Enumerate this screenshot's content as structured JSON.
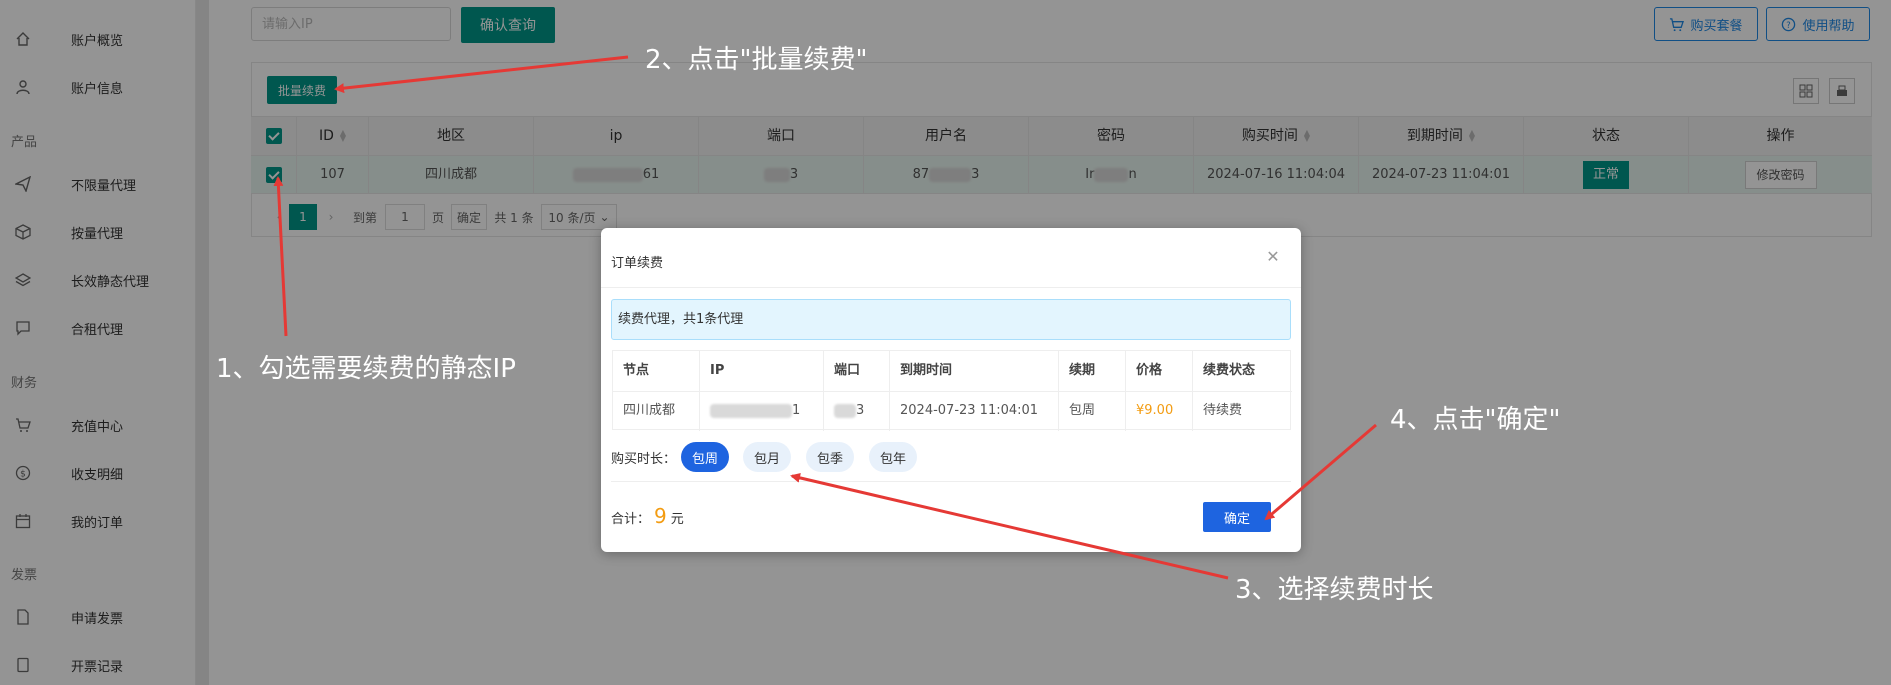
{
  "sidebar": {
    "items": [
      {
        "label": "账户概览",
        "icon": "home-icon"
      },
      {
        "label": "账户信息",
        "icon": "user-icon"
      },
      {
        "label": "不限量代理",
        "icon": "send-icon"
      },
      {
        "label": "按量代理",
        "icon": "box-icon"
      },
      {
        "label": "长效静态代理",
        "icon": "layers-icon"
      },
      {
        "label": "合租代理",
        "icon": "chat-icon"
      },
      {
        "label": "充值中心",
        "icon": "cart-icon"
      },
      {
        "label": "收支明细",
        "icon": "coin-icon"
      },
      {
        "label": "我的订单",
        "icon": "calendar-icon"
      },
      {
        "label": "申请发票",
        "icon": "file-icon"
      },
      {
        "label": "开票记录",
        "icon": "record-icon"
      }
    ],
    "sections": [
      "产品",
      "财务",
      "发票"
    ]
  },
  "toolbar": {
    "ip_placeholder": "请输入IP",
    "query_label": "确认查询",
    "buy_label": "购买套餐",
    "help_label": "使用帮助",
    "batch_label": "批量续费"
  },
  "table": {
    "headers": [
      "ID",
      "地区",
      "ip",
      "端口",
      "用户名",
      "密码",
      "购买时间",
      "到期时间",
      "状态",
      "操作"
    ],
    "row": {
      "id": "107",
      "region": "四川成都",
      "ip_tail": "61",
      "port_tail": "3",
      "user_prefix": "87",
      "user_tail": "3",
      "pwd_prefix": "Ir",
      "pwd_tail": "n",
      "buy_time": "2024-07-16 11:04:04",
      "expire_time": "2024-07-23 11:04:01",
      "status": "正常",
      "action": "修改密码"
    }
  },
  "pager": {
    "current": "1",
    "goto_label": "到第",
    "page_value": "1",
    "page_unit": "页",
    "confirm_label": "确定",
    "total_label": "共 1 条",
    "size_label": "10 条/页"
  },
  "modal": {
    "title": "订单续费",
    "info": "续费代理，共1条代理",
    "headers": [
      "节点",
      "IP",
      "端口",
      "到期时间",
      "续期",
      "价格",
      "续费状态"
    ],
    "row": {
      "node": "四川成都",
      "ip_tail": "1",
      "port_tail": "3",
      "expire_time": "2024-07-23 11:04:01",
      "renew": "包周",
      "price": "¥9.00",
      "status": "待续费"
    },
    "duration_label": "购买时长：",
    "durations": [
      "包周",
      "包月",
      "包季",
      "包年"
    ],
    "total_label": "合计：",
    "total_value": "9",
    "total_unit": "元",
    "confirm_label": "确定"
  },
  "annotations": {
    "step1": "1、勾选需要续费的静态IP",
    "step2": "2、点击\"批量续费\"",
    "step3": "3、选择续费时长",
    "step4": "4、点击\"确定\""
  },
  "colors": {
    "primary_green": "#009688",
    "primary_blue": "#1e64e0",
    "price_orange": "#f39c12",
    "arrow_red": "#e53935"
  }
}
